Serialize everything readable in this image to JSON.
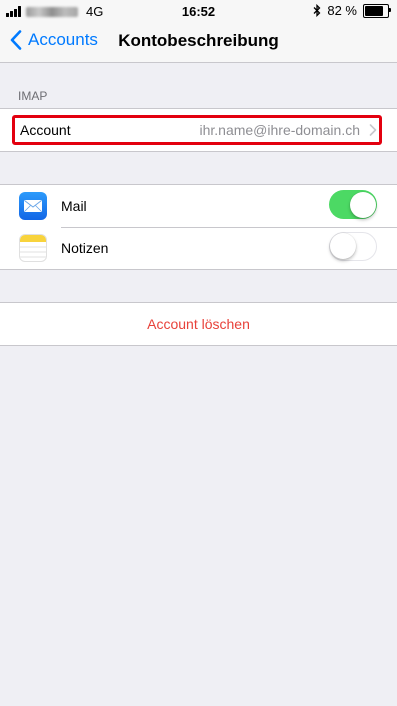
{
  "status_bar": {
    "network": "4G",
    "time": "16:52",
    "battery_text": "82 %",
    "battery_level": 0.82
  },
  "nav": {
    "back_label": "Accounts",
    "title": "Kontobeschreibung"
  },
  "imap_section": {
    "header": "IMAP",
    "account_label": "Account",
    "account_value": "ihr.name@ihre-domain.ch"
  },
  "apps": [
    {
      "label": "Mail",
      "enabled": true
    },
    {
      "label": "Notizen",
      "enabled": false
    }
  ],
  "delete_label": "Account löschen",
  "colors": {
    "accent": "#007aff",
    "toggle_on": "#4cd964",
    "destructive": "#e8423a",
    "highlight": "#e3000f"
  }
}
